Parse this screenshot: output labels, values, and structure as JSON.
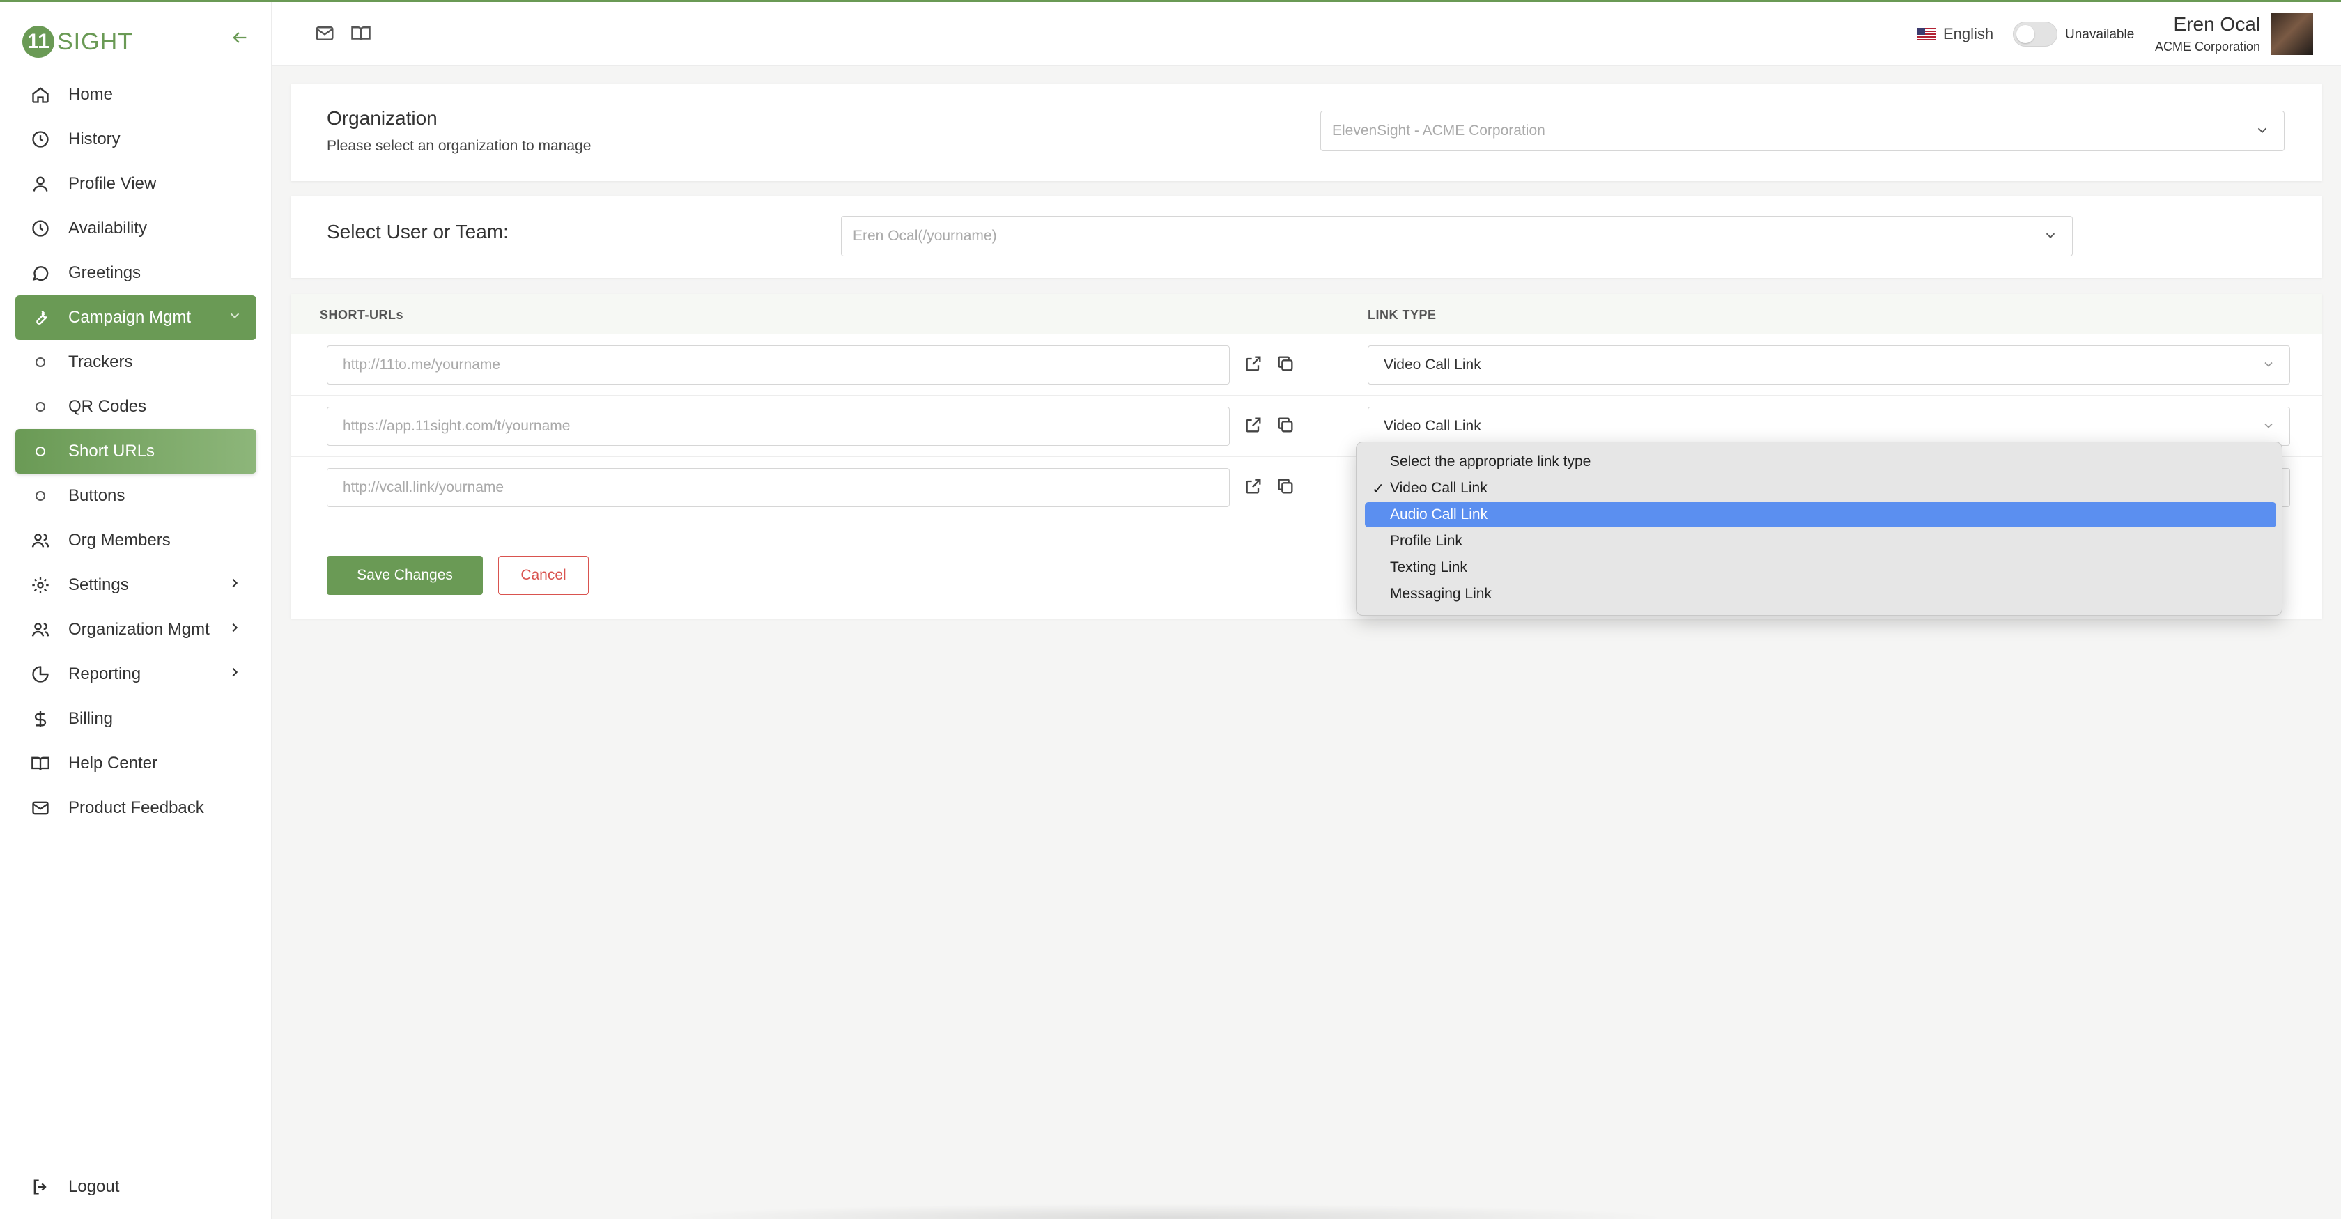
{
  "app": {
    "logo_mark": "11",
    "logo_text": "SIGHT",
    "brand_color": "#6a9a55"
  },
  "sidebar": {
    "items": [
      {
        "label": "Home",
        "icon": "home-icon"
      },
      {
        "label": "History",
        "icon": "clock-icon"
      },
      {
        "label": "Profile View",
        "icon": "user-icon"
      },
      {
        "label": "Availability",
        "icon": "clock-icon"
      },
      {
        "label": "Greetings",
        "icon": "chat-icon"
      },
      {
        "label": "Campaign Mgmt",
        "icon": "wrench-icon",
        "active": true
      },
      {
        "label": "Trackers",
        "sub": true
      },
      {
        "label": "QR Codes",
        "sub": true
      },
      {
        "label": "Short URLs",
        "sub": true,
        "selected": true
      },
      {
        "label": "Buttons",
        "sub": true
      },
      {
        "label": "Org Members",
        "icon": "users-icon"
      },
      {
        "label": "Settings",
        "icon": "gear-icon",
        "expandable": true
      },
      {
        "label": "Organization Mgmt",
        "icon": "users-icon",
        "expandable": true
      },
      {
        "label": "Reporting",
        "icon": "pie-chart-icon",
        "expandable": true
      },
      {
        "label": "Billing",
        "icon": "dollar-icon"
      },
      {
        "label": "Help Center",
        "icon": "book-icon"
      },
      {
        "label": "Product Feedback",
        "icon": "mail-icon"
      }
    ],
    "logout_label": "Logout"
  },
  "topbar": {
    "language": "English",
    "status": "Unavailable",
    "user_name": "Eren Ocal",
    "user_org": "ACME Corporation"
  },
  "organization": {
    "title": "Organization",
    "subtitle": "Please select an organization to manage",
    "selected": "ElevenSight - ACME Corporation"
  },
  "user_team": {
    "title": "Select User or Team:",
    "selected": "Eren Ocal(/yourname)"
  },
  "table": {
    "col_short_urls": "SHORT-URLs",
    "col_link_type": "LINK TYPE",
    "rows": [
      {
        "url": "http://11to.me/yourname",
        "link_type": "Video Call Link"
      },
      {
        "url": "https://app.11sight.com/t/yourname",
        "link_type": "Video Call Link"
      },
      {
        "url": "http://vcall.link/yourname",
        "link_type": ""
      }
    ]
  },
  "actions": {
    "save_label": "Save Changes",
    "cancel_label": "Cancel"
  },
  "dropdown": {
    "options": [
      {
        "label": "Select the appropriate link type",
        "checked": false,
        "highlighted": false
      },
      {
        "label": "Video Call Link",
        "checked": true,
        "highlighted": false
      },
      {
        "label": "Audio Call Link",
        "checked": false,
        "highlighted": true
      },
      {
        "label": "Profile Link",
        "checked": false,
        "highlighted": false
      },
      {
        "label": "Texting Link",
        "checked": false,
        "highlighted": false
      },
      {
        "label": "Messaging Link",
        "checked": false,
        "highlighted": false
      }
    ],
    "check_mark": "✓",
    "highlight_color": "#5b8ff0"
  }
}
